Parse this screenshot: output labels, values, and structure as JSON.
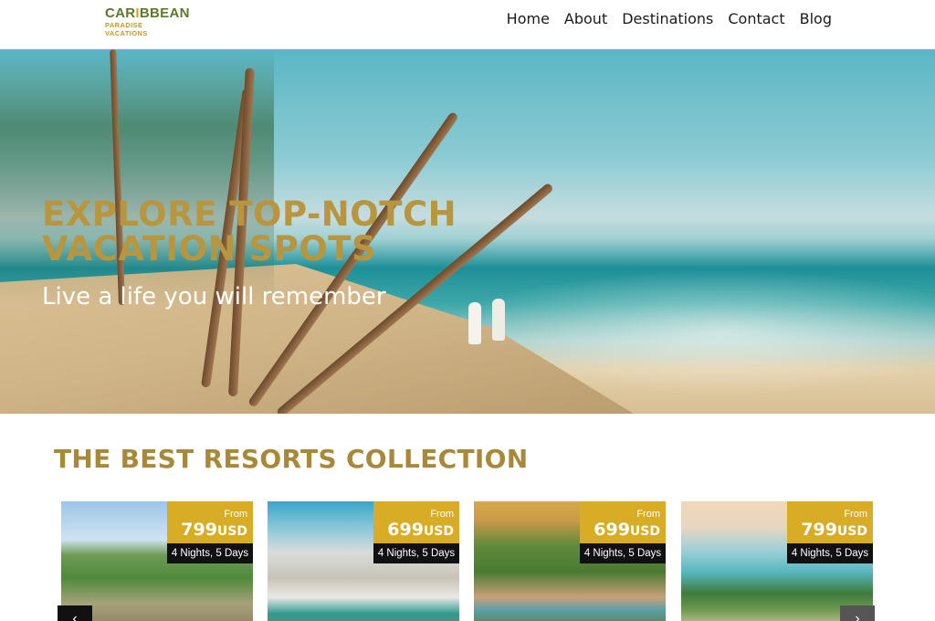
{
  "brand": {
    "logo_top": "CAR",
    "logo_palm": "I",
    "logo_top_rest": "BBEAN",
    "logo_bottom": "PARADISE VACATIONS"
  },
  "nav": {
    "items": [
      "Home",
      "About",
      "Destinations",
      "Contact",
      "Blog"
    ]
  },
  "hero": {
    "title": "EXPLORE TOP-NOTCH VACATION SPOTS",
    "subtitle": "Live a life you will remember"
  },
  "resorts": {
    "section_title": "THE BEST RESORTS COLLECTION",
    "cards": [
      {
        "from_label": "From",
        "price": "799",
        "currency": "USD",
        "duration": "4 Nights, 5 Days"
      },
      {
        "from_label": "From",
        "price": "699",
        "currency": "USD",
        "duration": "4 Nights, 5 Days"
      },
      {
        "from_label": "From",
        "price": "699",
        "currency": "USD",
        "duration": "4 Nights, 5 Days"
      },
      {
        "from_label": "From",
        "price": "799",
        "currency": "USD",
        "duration": "4 Nights, 5 Days"
      }
    ]
  },
  "colors": {
    "accent_gold": "#d9ac26",
    "title_gold": "#a8893a",
    "hero_title": "#b8963f"
  },
  "icons": {
    "prev": "chevron-left-icon",
    "next": "chevron-right-icon"
  }
}
